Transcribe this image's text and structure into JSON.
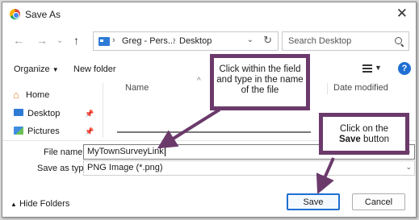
{
  "window": {
    "title": "Save As"
  },
  "address_bar": {
    "crumb_user": "Greg - Pers...",
    "crumb_folder": "Desktop"
  },
  "search": {
    "placeholder": "Search Desktop"
  },
  "toolbar": {
    "organize": "Organize",
    "new_folder": "New folder"
  },
  "nav_pane": {
    "items": [
      {
        "label": "Home"
      },
      {
        "label": "Desktop"
      },
      {
        "label": "Pictures"
      }
    ]
  },
  "file_list": {
    "columns": {
      "name": "Name",
      "date_modified": "Date modified"
    }
  },
  "form": {
    "file_name_label": "File name:",
    "file_name_value": "MyTownSurveyLink",
    "save_type_label": "Save as type:",
    "save_type_value": "PNG Image (*.png)"
  },
  "footer": {
    "hide_folders": "Hide Folders",
    "save": "Save",
    "cancel": "Cancel"
  },
  "callouts": {
    "file_name_text": "Click within the field and type in the name of the file",
    "save_prefix": "Click on the",
    "save_bold": "Save",
    "save_suffix": "button"
  },
  "colors": {
    "callout_border": "#6b3a6b",
    "accent": "#1f6fd1"
  }
}
